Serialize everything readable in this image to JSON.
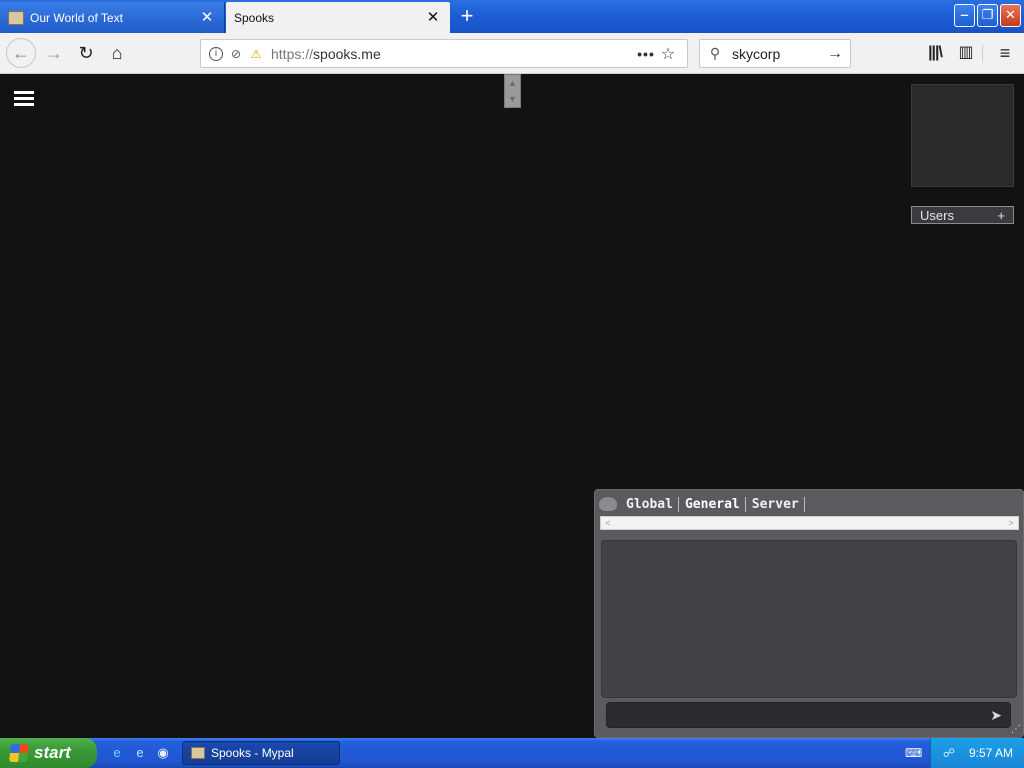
{
  "browser": {
    "tabs": [
      {
        "label": "Our World of Text",
        "close": "✕"
      },
      {
        "label": "Spooks",
        "close": "✕"
      }
    ],
    "new_tab": "+",
    "window_buttons": {
      "minimize": "‒",
      "maximize": "❐",
      "close": "✕"
    }
  },
  "navbar": {
    "back": "←",
    "forward": "→",
    "reload": "↻",
    "home": "⌂",
    "url_scheme": "https://",
    "url_host": "spooks.me",
    "page_actions": "•••",
    "bookmark": "☆",
    "search_icon": "⚲",
    "search_value": "skycorp",
    "search_go": "→",
    "library": "|||\\",
    "sidebar": "▥",
    "menu": "≡"
  },
  "page": {
    "users_label": "Users",
    "users_add": "+"
  },
  "chat": {
    "tabs": [
      "Global",
      "General",
      "Server"
    ],
    "active_tab": "General",
    "scroll_left": "<",
    "scroll_right": ">",
    "send": "➤",
    "grip": "⋰"
  },
  "taskbar": {
    "start_label": "start",
    "task_label": "Spooks - Mypal",
    "clock": "9:57 AM",
    "kbd": "⌨",
    "tray_icon": "☍",
    "ql_ie": "e",
    "ql_ie2": "e",
    "ql_media": "◉"
  },
  "colors": {
    "page_bg": "#121212",
    "titlebar": "#1d5ed4",
    "chat_panel": "#5a5a5f",
    "taskbar": "#245edb",
    "start_button": "#3a9a38"
  }
}
